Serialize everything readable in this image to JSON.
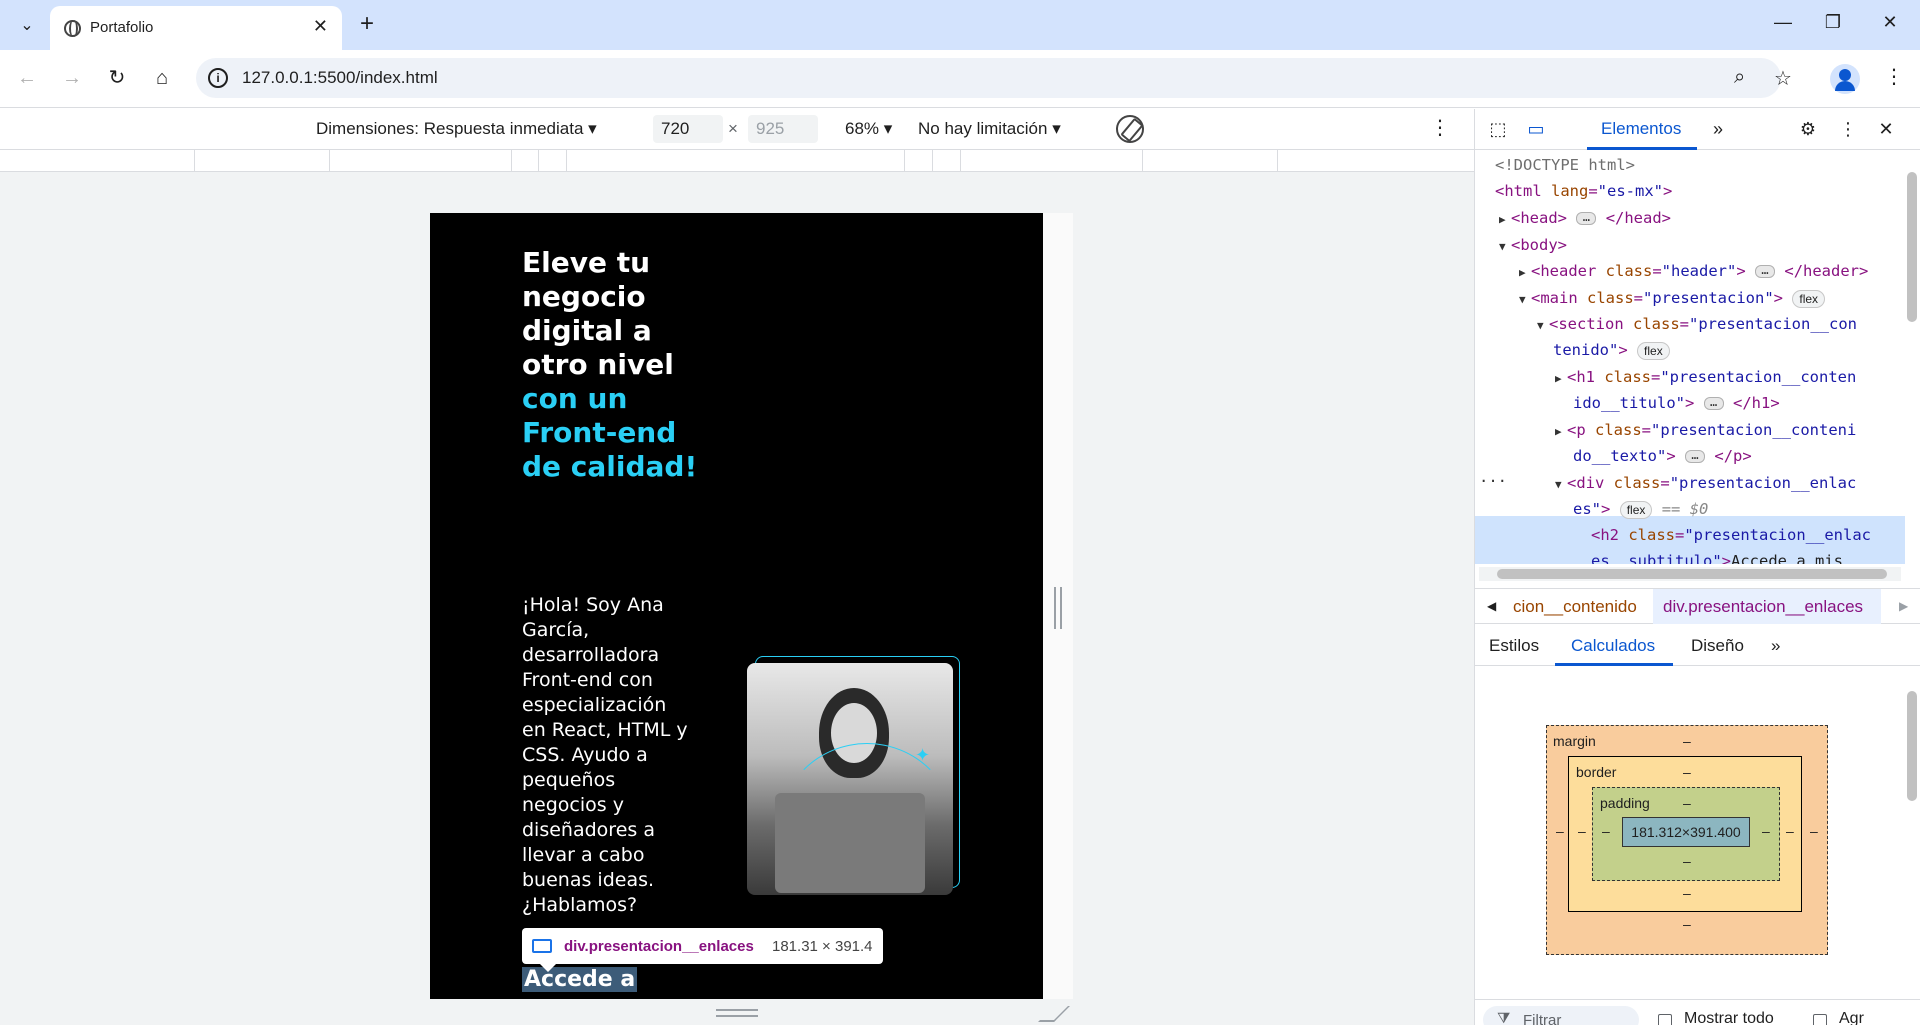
{
  "browser": {
    "tab_title": "Portafolio",
    "url": "127.0.0.1:5500/index.html"
  },
  "device_toolbar": {
    "dimensions_label": "Dimensiones: Respuesta inmediata",
    "width": "720",
    "height_placeholder": "925",
    "zoom": "68%",
    "throttle": "No hay limitación"
  },
  "site": {
    "title_white": "Eleve tu negocio digital a otro nivel",
    "title_accent": "con un Front-end de calidad!",
    "intro": "¡Hola! Soy Ana García, desarrolladora Front-end con especialización en React, HTML y CSS. Ayudo a pequeños negocios y diseñadores a llevar a cabo buenas ideas. ¿Hablamos?",
    "subtitle": "Accede a"
  },
  "tooltip": {
    "name": "div.presentacion__enlaces",
    "size": "181.31 × 391.4"
  },
  "devtools": {
    "active_tab": "Elementos",
    "dom_lines": [
      "<!DOCTYPE html>",
      "html lang es-mx",
      "head",
      "body",
      "header class header",
      "main class presentacion flex",
      "section class presentacion__contenido flex",
      "h1 class presentacion__contenido__titulo",
      "p class presentacion__contenido__texto",
      "div class presentacion__enlaces flex == $0",
      "h2 class presentacion__enlaces__subtitulo Accede a mis"
    ],
    "breadcrumb_prev": "cion__contenido",
    "breadcrumb_active": "div.presentacion__enlaces",
    "subtabs": [
      "Estilos",
      "Calculados",
      "Diseño"
    ],
    "active_subtab": "Calculados",
    "box_model": {
      "margin_label": "margin",
      "border_label": "border",
      "padding_label": "padding",
      "content_size": "181.312×391.400",
      "dash": "–"
    },
    "filter_placeholder": "Filtrar",
    "show_all": "Mostrar todo",
    "group": "Agr"
  }
}
